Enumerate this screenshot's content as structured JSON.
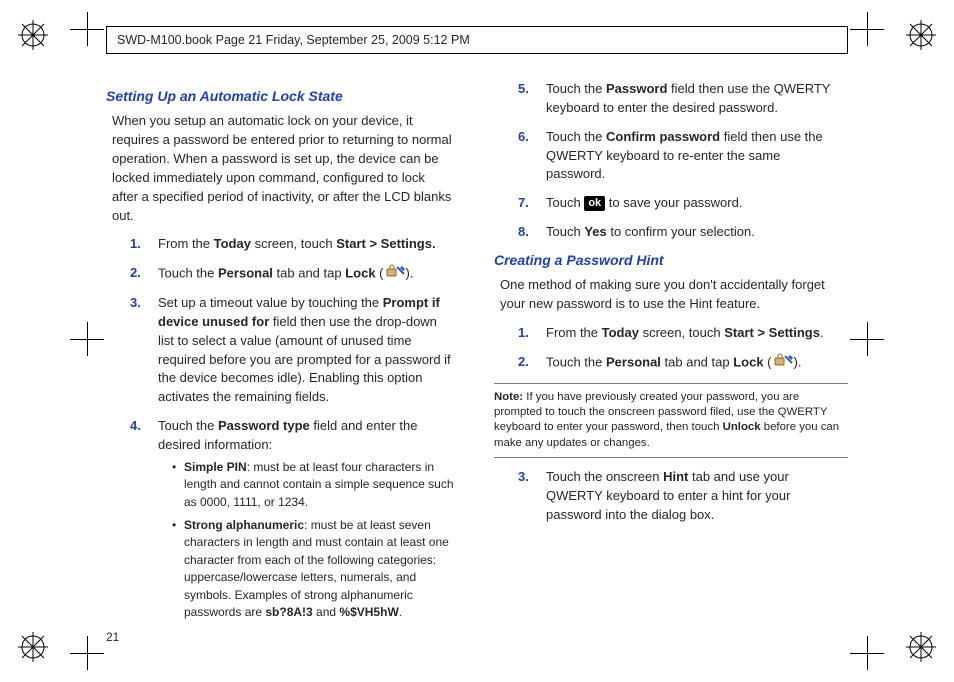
{
  "header": {
    "text": "SWD-M100.book  Page 21  Friday, September 25, 2009  5:12 PM"
  },
  "pageNumber": "21",
  "sectionA": {
    "heading": "Setting Up an Automatic Lock State",
    "paragraph": "When you setup an automatic lock on your device, it requires a password be entered prior to returning to normal operation. When a password is set up, the device can be locked immediately upon command, configured to lock after a specified period of inactivity, or after the LCD blanks out.",
    "steps": {
      "s1_pre": "From the ",
      "s1_b1": "Today",
      "s1_mid": " screen, touch ",
      "s1_b2": "Start > Settings.",
      "s2_pre": "Touch the ",
      "s2_b1": "Personal",
      "s2_mid": " tab and tap ",
      "s2_b2": "Lock",
      "s2_post": " (",
      "s2_close": ").",
      "s3_pre": "Set up a timeout value by touching the ",
      "s3_b1": "Prompt if device unused for",
      "s3_post": " field then use the drop-down list to select a value (amount of unused time required before you are prompted for a password if the device becomes idle). Enabling this option activates the remaining fields.",
      "s4_pre": "Touch the ",
      "s4_b1": "Password type",
      "s4_post": " field and enter the desired information:",
      "bul1_b": "Simple PIN",
      "bul1_t": ": must be at least four characters in length and cannot contain a simple sequence such as 0000, 1111, or 1234.",
      "bul2_b": "Strong alphanumeric",
      "bul2_t1": ": must be at least seven characters in length and must contain at least one character from each of the following categories: uppercase/lowercase letters, numerals, and symbols. Examples of strong alphanumeric passwords are ",
      "bul2_ex1": "sb?8A!3",
      "bul2_t2": " and ",
      "bul2_ex2": "%$VH5hW",
      "bul2_t3": ".",
      "s5_pre": "Touch the ",
      "s5_b1": "Password",
      "s5_post": " field then use the QWERTY keyboard to enter the desired password.",
      "s6_pre": "Touch the ",
      "s6_b1": "Confirm password",
      "s6_post": " field then use the QWERTY keyboard to re-enter the same password.",
      "s7_pre": "Touch ",
      "s7_ok": "ok",
      "s7_post": " to save your password.",
      "s8_pre": "Touch ",
      "s8_b1": "Yes",
      "s8_post": " to confirm your selection."
    }
  },
  "sectionB": {
    "heading": "Creating a Password Hint",
    "paragraph": "One method of making sure you don't accidentally forget your new password is to use the Hint feature.",
    "steps": {
      "s1_pre": "From the ",
      "s1_b1": "Today",
      "s1_mid": " screen, touch ",
      "s1_b2": "Start > Settings",
      "s1_post": ".",
      "s2_pre": "Touch the ",
      "s2_b1": "Personal",
      "s2_mid": " tab and tap ",
      "s2_b2": "Lock",
      "s2_post": " (",
      "s2_close": ").",
      "s3_pre": "Touch the onscreen ",
      "s3_b1": "Hint",
      "s3_post": " tab and use your QWERTY keyboard to enter a hint for your password into the dialog box."
    },
    "note": {
      "key": "Note:",
      "text1": "If you have previously created your password, you are prompted to touch the onscreen password filed, use the QWERTY keyboard to enter your password, then touch ",
      "bold": "Unlock",
      "text2": " before you can make any updates or changes."
    }
  }
}
